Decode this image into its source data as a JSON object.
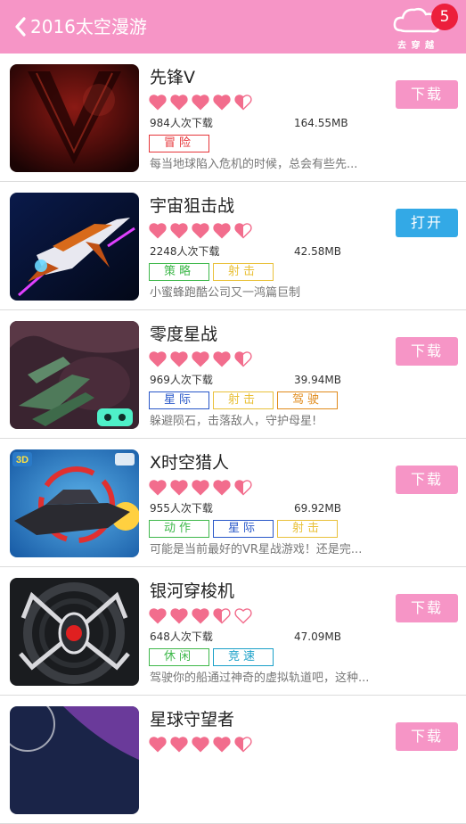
{
  "header": {
    "title": "2016太空漫游",
    "go_label": "去 穿 越",
    "badge_count": "5",
    "bg_color": "#f695c6"
  },
  "apps": [
    {
      "name": "先锋V",
      "rating": 4.5,
      "downloads": "984人次下载",
      "size": "164.55MB",
      "tags": [
        {
          "text": "冒险",
          "color": "#e6363a"
        }
      ],
      "desc": "每当地球陷入危机的时候，总会有些先...",
      "action": "下载",
      "action_color": "#f695c6",
      "thumb_icon": "red-v-logo-thumbnail"
    },
    {
      "name": "宇宙狙击战",
      "rating": 4.5,
      "downloads": "2248人次下载",
      "size": "42.58MB",
      "tags": [
        {
          "text": "策略",
          "color": "#3fb84b"
        },
        {
          "text": "射击",
          "color": "#e9c13a"
        }
      ],
      "desc": "小蜜蜂跑酷公司又一鸿篇巨制",
      "action": "打开",
      "action_color": "#33a9e6",
      "thumb_icon": "fighter-jet-thumbnail"
    },
    {
      "name": "零度星战",
      "rating": 4.5,
      "downloads": "969人次下载",
      "size": "39.94MB",
      "tags": [
        {
          "text": "星际",
          "color": "#2857c8"
        },
        {
          "text": "射击",
          "color": "#e9c13a"
        },
        {
          "text": "驾驶",
          "color": "#e08a1a"
        }
      ],
      "desc": "躲避陨石，击落敌人，守护母星!",
      "action": "下载",
      "action_color": "#f695c6",
      "thumb_icon": "spaceship-asteroids-thumbnail"
    },
    {
      "name": "X时空猎人",
      "rating": 4.5,
      "downloads": "955人次下载",
      "size": "69.92MB",
      "tags": [
        {
          "text": "动作",
          "color": "#3fb84b"
        },
        {
          "text": "星际",
          "color": "#2857c8"
        },
        {
          "text": "射击",
          "color": "#e9c13a"
        }
      ],
      "desc": "可能是当前最好的VR星战游戏！还是完...",
      "action": "下载",
      "action_color": "#f695c6",
      "thumb_icon": "3d-battleship-thumbnail",
      "thumb_text": "3D"
    },
    {
      "name": "银河穿梭机",
      "rating": 3.5,
      "downloads": "648人次下载",
      "size": "47.09MB",
      "tags": [
        {
          "text": "休闲",
          "color": "#3fb84b"
        },
        {
          "text": "竞速",
          "color": "#1aa0c8"
        }
      ],
      "desc": "驾驶你的船通过神奇的虚拟轨道吧，这种...",
      "action": "下载",
      "action_color": "#f695c6",
      "thumb_icon": "spider-robot-thumbnail"
    },
    {
      "name": "星球守望者",
      "rating": 4.5,
      "downloads": "",
      "size": "",
      "tags": [],
      "desc": "",
      "action": "下载",
      "action_color": "#f695c6",
      "thumb_icon": "planet-watcher-thumbnail"
    }
  ]
}
